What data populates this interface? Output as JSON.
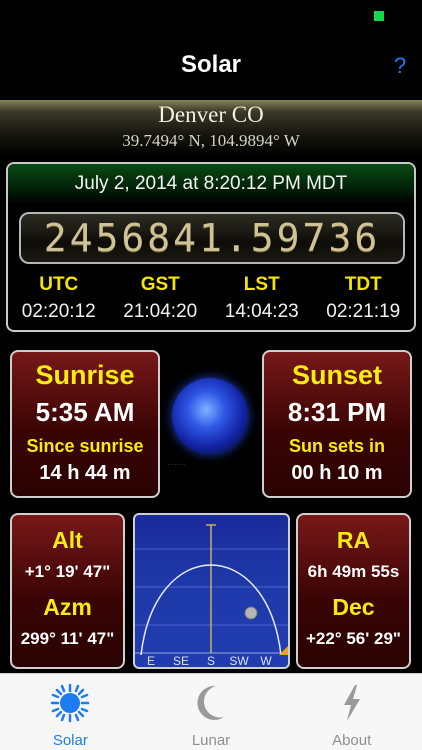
{
  "nav": {
    "title": "Solar",
    "help_label": "?"
  },
  "location": {
    "name": "Denver CO",
    "coords": "39.7494° N, 104.9894° W"
  },
  "time": {
    "datetime": "July 2, 2014 at 8:20:12 PM MDT",
    "julian_day": "2456841.59736",
    "zones": [
      {
        "label": "UTC",
        "value": "02:20:12"
      },
      {
        "label": "GST",
        "value": "21:04:20"
      },
      {
        "label": "LST",
        "value": "14:04:23"
      },
      {
        "label": "TDT",
        "value": "02:21:19"
      }
    ]
  },
  "sunrise": {
    "title": "Sunrise",
    "time": "5:35 AM",
    "sub_label": "Since sunrise",
    "sub_value": "14 h 44 m"
  },
  "sunset": {
    "title": "Sunset",
    "time": "8:31 PM",
    "sub_label": "Sun sets in",
    "sub_value": "00 h 10 m"
  },
  "altaz": {
    "alt_label": "Alt",
    "alt_value": "+1° 19' 47\"",
    "azm_label": "Azm",
    "azm_value": "299° 11' 47\""
  },
  "radec": {
    "ra_label": "RA",
    "ra_value": "6h 49m 55s",
    "dec_label": "Dec",
    "dec_value": "+22° 56' 29\""
  },
  "sky_chart": {
    "directions": [
      "E",
      "SE",
      "S",
      "SW",
      "W"
    ]
  },
  "tabs": [
    {
      "label": "Solar",
      "icon": "sun-icon",
      "active": true
    },
    {
      "label": "Lunar",
      "icon": "moon-icon",
      "active": false
    },
    {
      "label": "About",
      "icon": "lightning-icon",
      "active": false
    }
  ],
  "colors": {
    "accent": "#1d7cf2",
    "highlight": "#f7ec10",
    "panel_red": "#781818"
  }
}
